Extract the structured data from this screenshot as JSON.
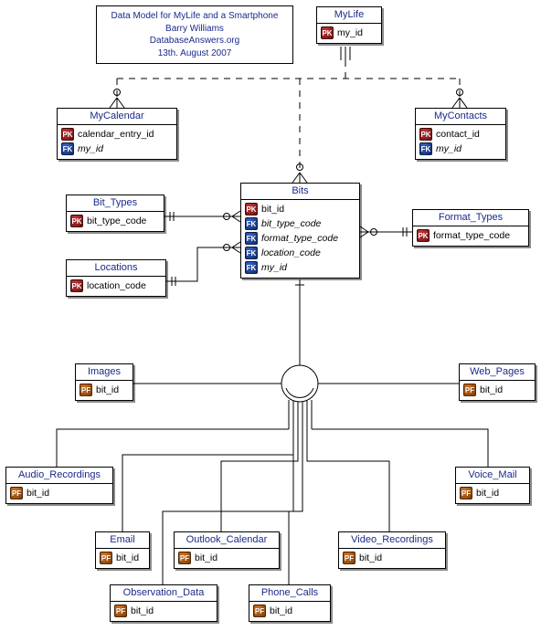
{
  "title_box": {
    "line1": "Data Model for MyLife and a Smartphone",
    "line2": "Barry Williams",
    "line3": "DatabaseAnswers.org",
    "line4": "13th. August 2007"
  },
  "entities": {
    "MyLife": {
      "name": "MyLife",
      "attributes": [
        {
          "key": "PK",
          "label": "my_id",
          "italic": false
        }
      ]
    },
    "MyCalendar": {
      "name": "MyCalendar",
      "attributes": [
        {
          "key": "PK",
          "label": "calendar_entry_id",
          "italic": false
        },
        {
          "key": "FK",
          "label": "my_id",
          "italic": true
        }
      ]
    },
    "MyContacts": {
      "name": "MyContacts",
      "attributes": [
        {
          "key": "PK",
          "label": "contact_id",
          "italic": false
        },
        {
          "key": "FK",
          "label": "my_id",
          "italic": true
        }
      ]
    },
    "Bits": {
      "name": "Bits",
      "attributes": [
        {
          "key": "PK",
          "label": "bit_id",
          "italic": false
        },
        {
          "key": "FK",
          "label": "bit_type_code",
          "italic": true
        },
        {
          "key": "FK",
          "label": "format_type_code",
          "italic": true
        },
        {
          "key": "FK",
          "label": "location_code",
          "italic": true
        },
        {
          "key": "FK",
          "label": "my_id",
          "italic": true
        }
      ]
    },
    "Bit_Types": {
      "name": "Bit_Types",
      "attributes": [
        {
          "key": "PK",
          "label": "bit_type_code",
          "italic": false
        }
      ]
    },
    "Locations": {
      "name": "Locations",
      "attributes": [
        {
          "key": "PK",
          "label": "location_code",
          "italic": false
        }
      ]
    },
    "Format_Types": {
      "name": "Format_Types",
      "attributes": [
        {
          "key": "PK",
          "label": "format_type_code",
          "italic": false
        }
      ]
    },
    "Images": {
      "name": "Images",
      "attributes": [
        {
          "key": "PF",
          "label": "bit_id",
          "italic": false
        }
      ]
    },
    "Web_Pages": {
      "name": "Web_Pages",
      "attributes": [
        {
          "key": "PF",
          "label": "bit_id",
          "italic": false
        }
      ]
    },
    "Audio_Recordings": {
      "name": "Audio_Recordings",
      "attributes": [
        {
          "key": "PF",
          "label": "bit_id",
          "italic": false
        }
      ]
    },
    "Voice_Mail": {
      "name": "Voice_Mail",
      "attributes": [
        {
          "key": "PF",
          "label": "bit_id",
          "italic": false
        }
      ]
    },
    "Email": {
      "name": "Email",
      "attributes": [
        {
          "key": "PF",
          "label": "bit_id",
          "italic": false
        }
      ]
    },
    "Outlook_Calendar": {
      "name": "Outlook_Calendar",
      "attributes": [
        {
          "key": "PF",
          "label": "bit_id",
          "italic": false
        }
      ]
    },
    "Video_Recordings": {
      "name": "Video_Recordings",
      "attributes": [
        {
          "key": "PF",
          "label": "bit_id",
          "italic": false
        }
      ]
    },
    "Observation_Data": {
      "name": "Observation_Data",
      "attributes": [
        {
          "key": "PF",
          "label": "bit_id",
          "italic": false
        }
      ]
    },
    "Phone_Calls": {
      "name": "Phone_Calls",
      "attributes": [
        {
          "key": "PF",
          "label": "bit_id",
          "italic": false
        }
      ]
    }
  },
  "chart_data": {
    "type": "er-diagram",
    "title": "Data Model for MyLife and a Smartphone",
    "author": "Barry Williams",
    "source": "DatabaseAnswers.org",
    "date": "13th. August 2007",
    "entities": [
      {
        "name": "MyLife",
        "keys": [
          {
            "col": "my_id",
            "type": "PK"
          }
        ]
      },
      {
        "name": "MyCalendar",
        "keys": [
          {
            "col": "calendar_entry_id",
            "type": "PK"
          },
          {
            "col": "my_id",
            "type": "FK"
          }
        ]
      },
      {
        "name": "MyContacts",
        "keys": [
          {
            "col": "contact_id",
            "type": "PK"
          },
          {
            "col": "my_id",
            "type": "FK"
          }
        ]
      },
      {
        "name": "Bits",
        "keys": [
          {
            "col": "bit_id",
            "type": "PK"
          },
          {
            "col": "bit_type_code",
            "type": "FK"
          },
          {
            "col": "format_type_code",
            "type": "FK"
          },
          {
            "col": "location_code",
            "type": "FK"
          },
          {
            "col": "my_id",
            "type": "FK"
          }
        ]
      },
      {
        "name": "Bit_Types",
        "keys": [
          {
            "col": "bit_type_code",
            "type": "PK"
          }
        ]
      },
      {
        "name": "Locations",
        "keys": [
          {
            "col": "location_code",
            "type": "PK"
          }
        ]
      },
      {
        "name": "Format_Types",
        "keys": [
          {
            "col": "format_type_code",
            "type": "PK"
          }
        ]
      },
      {
        "name": "Images",
        "keys": [
          {
            "col": "bit_id",
            "type": "PF"
          }
        ]
      },
      {
        "name": "Web_Pages",
        "keys": [
          {
            "col": "bit_id",
            "type": "PF"
          }
        ]
      },
      {
        "name": "Audio_Recordings",
        "keys": [
          {
            "col": "bit_id",
            "type": "PF"
          }
        ]
      },
      {
        "name": "Voice_Mail",
        "keys": [
          {
            "col": "bit_id",
            "type": "PF"
          }
        ]
      },
      {
        "name": "Email",
        "keys": [
          {
            "col": "bit_id",
            "type": "PF"
          }
        ]
      },
      {
        "name": "Outlook_Calendar",
        "keys": [
          {
            "col": "bit_id",
            "type": "PF"
          }
        ]
      },
      {
        "name": "Video_Recordings",
        "keys": [
          {
            "col": "bit_id",
            "type": "PF"
          }
        ]
      },
      {
        "name": "Observation_Data",
        "keys": [
          {
            "col": "bit_id",
            "type": "PF"
          }
        ]
      },
      {
        "name": "Phone_Calls",
        "keys": [
          {
            "col": "bit_id",
            "type": "PF"
          }
        ]
      }
    ],
    "relationships": [
      {
        "from": "MyLife",
        "to": "MyCalendar",
        "type": "identifying",
        "cardinality": "1..*",
        "dashed": true
      },
      {
        "from": "MyLife",
        "to": "MyContacts",
        "type": "identifying",
        "cardinality": "1..*",
        "dashed": true
      },
      {
        "from": "MyLife",
        "to": "Bits",
        "type": "identifying",
        "cardinality": "1..*",
        "dashed": true
      },
      {
        "from": "Bit_Types",
        "to": "Bits",
        "type": "non-identifying",
        "cardinality": "1..*"
      },
      {
        "from": "Locations",
        "to": "Bits",
        "type": "non-identifying",
        "cardinality": "1..*"
      },
      {
        "from": "Format_Types",
        "to": "Bits",
        "type": "non-identifying",
        "cardinality": "1..*"
      },
      {
        "from": "Bits",
        "to": [
          "Images",
          "Web_Pages",
          "Audio_Recordings",
          "Voice_Mail",
          "Email",
          "Outlook_Calendar",
          "Video_Recordings",
          "Observation_Data",
          "Phone_Calls"
        ],
        "type": "subtype"
      }
    ]
  }
}
